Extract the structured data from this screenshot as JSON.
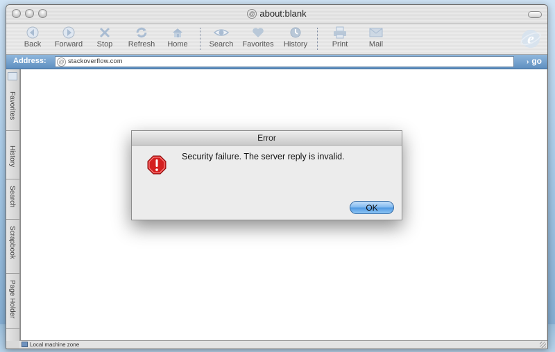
{
  "window": {
    "title": "about:blank"
  },
  "toolbar": {
    "buttons": [
      {
        "label": "Back",
        "icon": "back-arrow-icon"
      },
      {
        "label": "Forward",
        "icon": "forward-arrow-icon"
      },
      {
        "label": "Stop",
        "icon": "stop-x-icon"
      },
      {
        "label": "Refresh",
        "icon": "refresh-icon"
      },
      {
        "label": "Home",
        "icon": "home-icon"
      },
      {
        "label": "Search",
        "icon": "search-eye-icon"
      },
      {
        "label": "Favorites",
        "icon": "favorites-heart-icon"
      },
      {
        "label": "History",
        "icon": "history-clock-icon"
      },
      {
        "label": "Print",
        "icon": "printer-icon"
      },
      {
        "label": "Mail",
        "icon": "mail-icon"
      }
    ]
  },
  "address": {
    "label": "Address:",
    "url": "stackoverflow.com",
    "go_label": "go"
  },
  "sidebar": {
    "tabs": [
      {
        "label": "Favorites"
      },
      {
        "label": "History"
      },
      {
        "label": "Search"
      },
      {
        "label": "Scrapbook"
      },
      {
        "label": "Page Holder"
      }
    ]
  },
  "status": {
    "zone": "Local machine zone"
  },
  "dialog": {
    "title": "Error",
    "message": "Security failure.  The server reply is invalid.",
    "ok_label": "OK"
  },
  "colors": {
    "ok_button": "#6fb0ee",
    "alert_icon": "#d42020",
    "address_bar": "#6f9ccc"
  }
}
